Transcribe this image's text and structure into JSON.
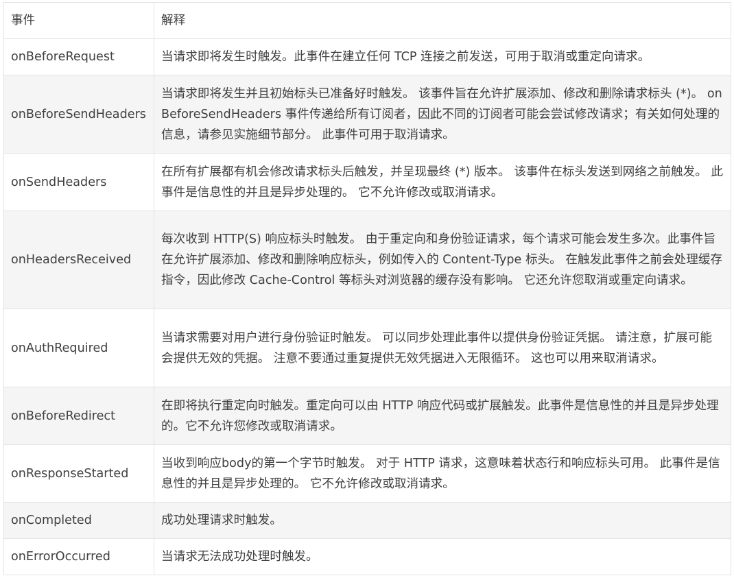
{
  "table": {
    "headers": [
      "事件",
      "解释"
    ],
    "rows": [
      {
        "event": "onBeforeRequest",
        "desc": "当请求即将发生时触发。此事件在建立任何 TCP 连接之前发送，可用于取消或重定向请求。"
      },
      {
        "event": "onBeforeSendHeaders",
        "desc": "当请求即将发生并且初始标头已准备好时触发。 该事件旨在允许扩展添加、修改和删除请求标头 (*)。 onBeforeSendHeaders 事件传递给所有订阅者，因此不同的订阅者可能会尝试修改请求；有关如何处理的信息，请参见实施细节部分。 此事件可用于取消请求。"
      },
      {
        "event": "onSendHeaders",
        "desc": "在所有扩展都有机会修改请求标头后触发，并呈现最终 (*) 版本。 该事件在标头发送到网络之前触发。 此事件是信息性的并且是异步处理的。 它不允许修改或取消请求。"
      },
      {
        "event": "onHeadersReceived",
        "desc": "每次收到 HTTP(S) 响应标头时触发。 由于重定向和身份验证请求，每个请求可能会发生多次。此事件旨在允许扩展添加、修改和删除响应标头，例如传入的 Content-Type 标头。 在触发此事件之前会处理缓存指令，因此修改 Cache-Control 等标头对浏览器的缓存没有影响。 它还允许您取消或重定向请求。"
      },
      {
        "event": "onAuthRequired",
        "desc": "当请求需要对用户进行身份验证时触发。 可以同步处理此事件以提供身份验证凭据。 请注意，扩展可能会提供无效的凭据。 注意不要通过重复提供无效凭据进入无限循环。 这也可以用来取消请求。"
      },
      {
        "event": "onBeforeRedirect",
        "desc": "在即将执行重定向时触发。重定向可以由 HTTP 响应代码或扩展触发。此事件是信息性的并且是异步处理的。它不允许您修改或取消请求。"
      },
      {
        "event": "onResponseStarted",
        "desc": "当收到响应body的第一个字节时触发。 对于 HTTP 请求，这意味着状态行和响应标头可用。 此事件是信息性的并且是异步处理的。 它不允许修改或取消请求。"
      },
      {
        "event": "onCompleted",
        "desc": "成功处理请求时触发。"
      },
      {
        "event": "onErrorOccurred",
        "desc": "当请求无法成功处理时触发。"
      }
    ]
  }
}
